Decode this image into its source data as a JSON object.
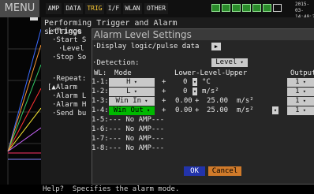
{
  "topbar": {
    "menu_label": "MENU",
    "tabs": [
      "AMP",
      "DATA",
      "TRIG",
      "I/F",
      "WLAN",
      "OTHER"
    ],
    "active_tab": "TRIG",
    "clock": [
      "2015-03-",
      "14:40:25"
    ]
  },
  "background": {
    "title": "Performing Trigger and Alarm settings",
    "items": [
      "[◦Trigge",
      "·Start S",
      "·Level",
      "·Stop So",
      "·Repeat:",
      "[▲Alarm",
      "·Alarm L",
      "·Alarm H",
      "·Send bu"
    ]
  },
  "dialog": {
    "title": "Alarm Level Settings",
    "display_logic_label": "·Display logic/pulse data",
    "detection_label": "·Detection:",
    "detection_value": "Level",
    "col_wl": "WL:",
    "col_mode": "Mode",
    "col_range": "Lower-Level-Upper",
    "col_output": "Output",
    "rows": [
      {
        "id": "1-1:",
        "mode": "H",
        "lower": "0",
        "upper": "",
        "unit": "°C",
        "output": "1"
      },
      {
        "id": "1-2:",
        "mode": "L",
        "lower": "0",
        "upper": "",
        "unit": "m/s²",
        "output": "1"
      },
      {
        "id": "1-3:",
        "mode": "Win In",
        "lower": "0.00",
        "upper": "25.00",
        "unit": "m/s²",
        "output": "1"
      },
      {
        "id": "1-4:",
        "mode": "Win Out",
        "lower": "0.00",
        "upper": "25.00",
        "unit": "m/s²",
        "output": "1"
      }
    ],
    "no_amp_rows": [
      "1-5:--- No AMP---",
      "1-6:--- No AMP---",
      "1-7:--- No AMP---",
      "1-8:--- No AMP---"
    ],
    "ok_label": "OK",
    "cancel_label": "Cancel"
  },
  "help_text": "Help?  Specifies the alarm mode."
}
